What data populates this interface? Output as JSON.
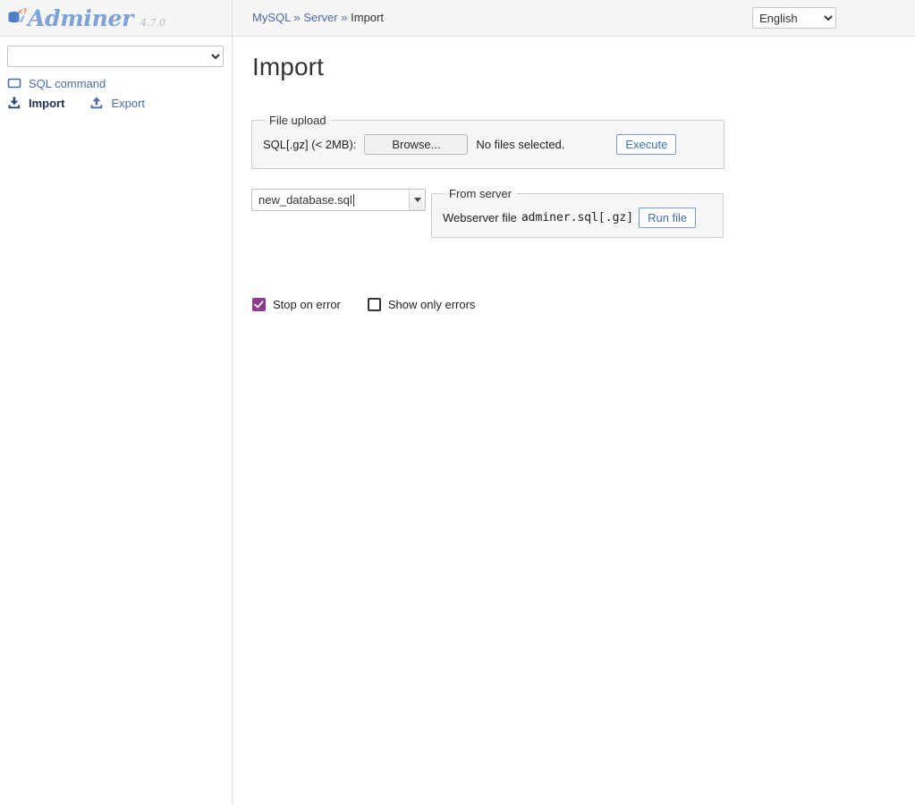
{
  "app": {
    "name": "Adminer",
    "version": "4.7.0",
    "logo_icon": "database-cylinder-icon",
    "accent_link": "#4e6ca8",
    "accent_checkbox": "#8e3a8e",
    "logo_color": "#7ca2d6"
  },
  "sidebar": {
    "db_select": {
      "value": "",
      "name": "database-select"
    },
    "links": [
      {
        "label": "SQL command",
        "icon": "sql-command-icon",
        "current": false
      },
      {
        "label": "Import",
        "icon": "import-icon",
        "current": true
      },
      {
        "label": "Export",
        "icon": "export-icon",
        "current": false
      }
    ]
  },
  "header": {
    "breadcrumb": {
      "items": [
        {
          "label": "MySQL",
          "link": true
        },
        {
          "label": "Server",
          "link": true
        },
        {
          "label": "Import",
          "link": false
        }
      ],
      "separator": "»"
    },
    "language": {
      "selected": "English",
      "options": [
        "English"
      ]
    }
  },
  "main": {
    "title": "Import",
    "file_upload": {
      "legend": "File upload",
      "label": "SQL[.gz] (< 2MB):",
      "browse_button": "Browse...",
      "file_status": "No files selected.",
      "execute_button": "Execute"
    },
    "webfile": {
      "value": "new_database.sql",
      "options": [
        "new_database.sql"
      ]
    },
    "from_server": {
      "legend": "From server",
      "label": "Webserver file",
      "filename": "adminer.sql[.gz]",
      "run_button": "Run file"
    },
    "options": [
      {
        "label": "Stop on error",
        "checked": true
      },
      {
        "label": "Show only errors",
        "checked": false
      }
    ]
  }
}
